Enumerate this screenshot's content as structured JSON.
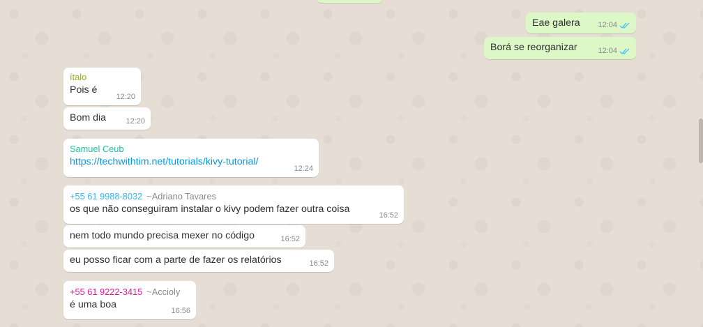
{
  "colors": {
    "outgoing_bubble": "#dcf8c6",
    "incoming_bubble": "#ffffff",
    "sender_italo": "#8fb11a",
    "sender_samuel": "#1ec2a5",
    "sender_adriano": "#35b5ef",
    "sender_accioly": "#e4169a",
    "read_ticks": "#4fc3f7",
    "link": "#039be5"
  },
  "outgoing": [
    {
      "text": "Eae galera",
      "time": "12:04",
      "status_icon": "double-check-read-icon"
    },
    {
      "text": "Borá se reorganizar",
      "time": "12:04",
      "status_icon": "double-check-read-icon"
    }
  ],
  "italo": {
    "sender": "ítalo",
    "messages": [
      {
        "text": "Pois é",
        "time": "12:20"
      },
      {
        "text": "Bom dia",
        "time": "12:20"
      }
    ]
  },
  "samuel": {
    "sender": "Samuel Ceub",
    "messages": [
      {
        "text": "https://techwithtim.net/tutorials/kivy-tutorial/",
        "time": "12:24"
      }
    ]
  },
  "adriano": {
    "sender": "+55 61 9988-8032",
    "pushname": "~Adriano Tavares",
    "messages": [
      {
        "text": "os que não conseguiram instalar o kivy podem fazer outra coisa",
        "time": "16:52"
      },
      {
        "text": "nem todo mundo precisa mexer no código",
        "time": "16:52"
      },
      {
        "text": "eu posso ficar com a parte de fazer os relatórios",
        "time": "16:52"
      }
    ]
  },
  "accioly": {
    "sender": "+55 61 9222-3415",
    "pushname": "~Accioly",
    "messages": [
      {
        "text": "é uma boa",
        "time": "16:56"
      }
    ]
  }
}
